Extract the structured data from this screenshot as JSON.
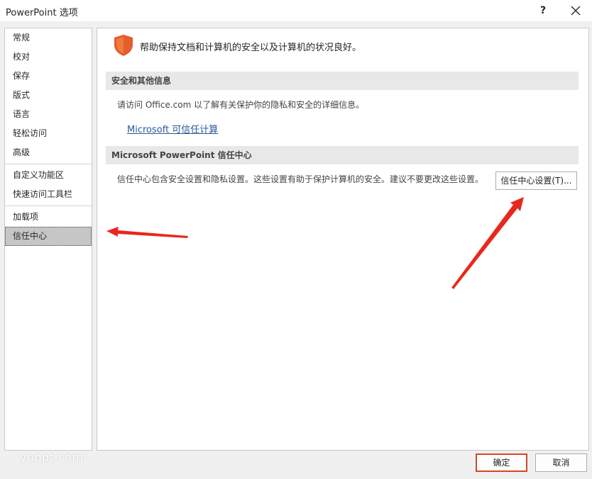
{
  "window": {
    "title": "PowerPoint 选项",
    "help_label": "?"
  },
  "nav": {
    "groups": [
      [
        "常规",
        "校对",
        "保存",
        "版式",
        "语言",
        "轻松访问",
        "高级"
      ],
      [
        "自定义功能区",
        "快速访问工具栏"
      ],
      [
        "加载项",
        "信任中心"
      ]
    ],
    "selected": "信任中心"
  },
  "content": {
    "header": "帮助保持文档和计算机的安全以及计算机的状况良好。",
    "section1": {
      "heading": "安全和其他信息",
      "text": "请访问 Office.com  以了解有关保护你的隐私和安全的详细信息。",
      "link": "Microsoft 可信任计算"
    },
    "section2": {
      "heading": "Microsoft PowerPoint 信任中心",
      "text": "信任中心包含安全设置和隐私设置。这些设置有助于保护计算机的安全。建议不要更改这些设置。",
      "button": "信任中心设置(T)..."
    }
  },
  "footer": {
    "ok": "确定",
    "cancel": "取消"
  },
  "watermark": "yoppt.com",
  "colors": {
    "shield": "#e8592a",
    "annotation_arrow": "#e8281e",
    "ok_border": "#d8452a",
    "link": "#2a5a9b"
  }
}
